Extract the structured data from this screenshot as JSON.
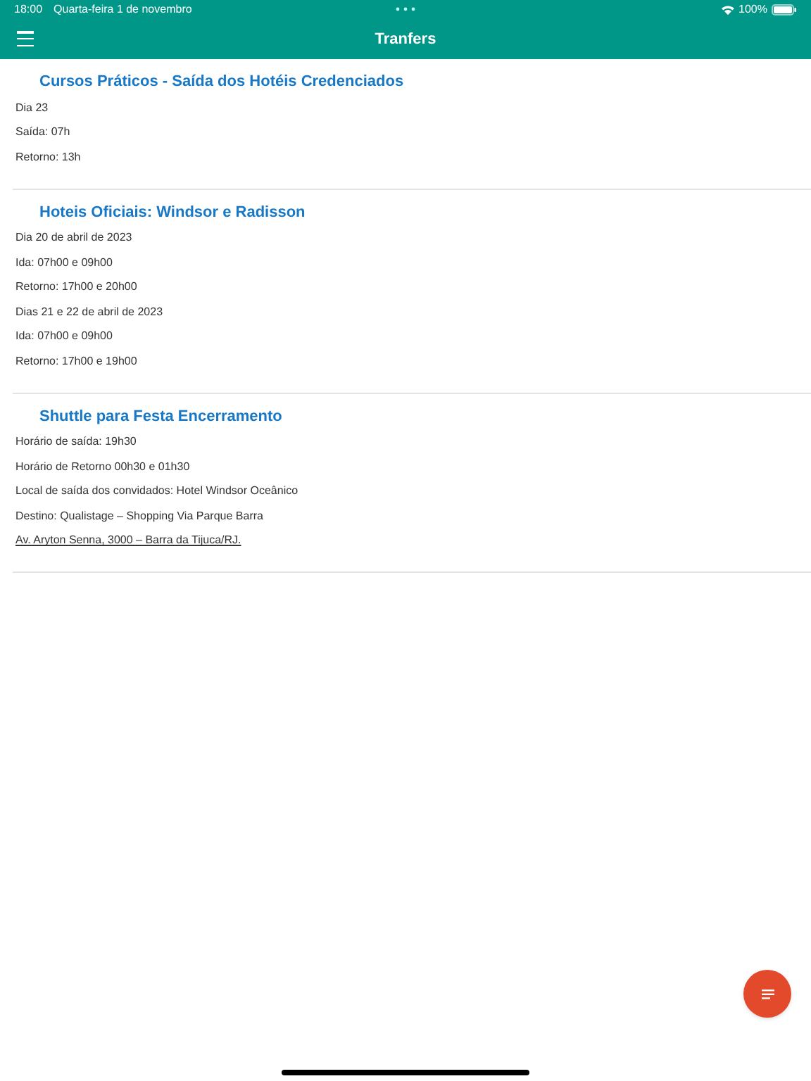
{
  "status_bar": {
    "time": "18:00",
    "date": "Quarta-feira 1 de novembro",
    "battery": "100%"
  },
  "nav_bar": {
    "title": "Tranfers"
  },
  "sections": [
    {
      "title": "Cursos Práticos - Saída dos Hotéis Credenciados",
      "lines": [
        {
          "text": "Dia 23",
          "kind": "text"
        },
        {
          "text": "Saída: 07h",
          "kind": "text"
        },
        {
          "text": "Retorno: 13h",
          "kind": "text"
        }
      ]
    },
    {
      "title": "Hoteis Oficiais: Windsor e Radisson",
      "lines": [
        {
          "text": "Dia 20 de abril de 2023",
          "kind": "text"
        },
        {
          "text": "Ida: 07h00 e  09h00",
          "kind": "text"
        },
        {
          "text": "Retorno: 17h00 e 20h00",
          "kind": "text"
        },
        {
          "text": "Dias 21 e 22 de abril de 2023",
          "kind": "text"
        },
        {
          "text": "Ida: 07h00 e  09h00",
          "kind": "text"
        },
        {
          "text": "Retorno: 17h00 e 19h00",
          "kind": "text"
        }
      ]
    },
    {
      "title": "Shuttle para Festa Encerramento",
      "lines": [
        {
          "text": "Horário de saída: 19h30",
          "kind": "text"
        },
        {
          "text": "Horário de Retorno 00h30 e 01h30",
          "kind": "text"
        },
        {
          "text": "Local de saída dos convidados: Hotel Windsor Oceânico",
          "kind": "text"
        },
        {
          "text": "Destino: Qualistage – Shopping Via Parque Barra",
          "kind": "text"
        },
        {
          "text": "Av. Aryton Senna, 3000 – Barra da Tijuca/RJ.",
          "kind": "link"
        }
      ]
    }
  ]
}
